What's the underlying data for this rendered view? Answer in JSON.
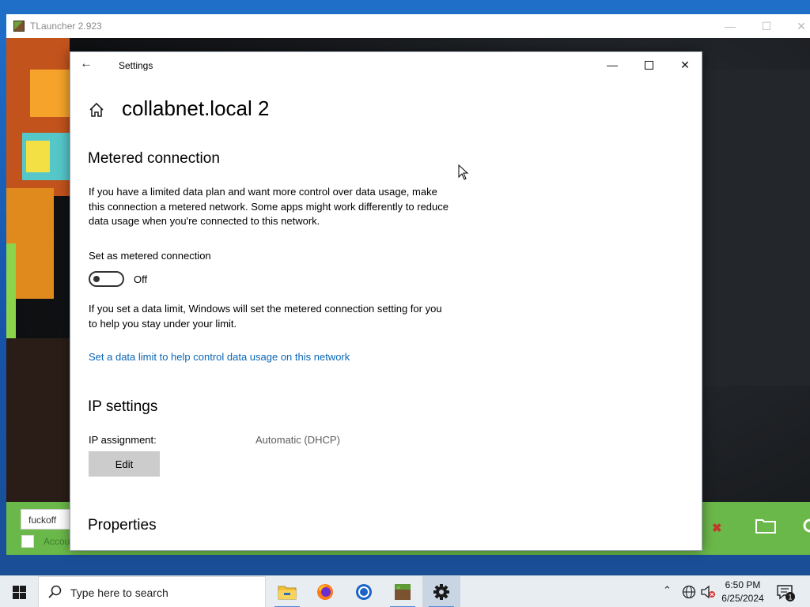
{
  "tlauncher": {
    "title": "TLauncher 2.923",
    "username": "fuckoff",
    "accounts_label": "Accounts"
  },
  "settings": {
    "app_title": "Settings",
    "page_title": "collabnet.local 2",
    "metered": {
      "title": "Metered connection",
      "description": "If you have a limited data plan and want more control over data usage, make this connection a metered network. Some apps might work differently to reduce data usage when you're connected to this network.",
      "toggle_label": "Set as metered connection",
      "toggle_state": "Off",
      "toggle_on": false,
      "data_limit_note": "If you set a data limit, Windows will set the metered connection setting for you to help you stay under your limit.",
      "data_limit_link": "Set a data limit to help control data usage on this network"
    },
    "ip": {
      "title": "IP settings",
      "assignment_label": "IP assignment:",
      "assignment_value": "Automatic (DHCP)",
      "edit_label": "Edit"
    },
    "properties": {
      "title": "Properties"
    }
  },
  "taskbar": {
    "search_placeholder": "Type here to search",
    "apps": [
      "file-explorer",
      "firefox",
      "chrome",
      "tlauncher",
      "settings"
    ],
    "clock_time": "6:50 PM",
    "clock_date": "6/25/2024",
    "notification_count": "1"
  },
  "colors": {
    "link": "#0a66b6",
    "tlauncher_green": "#6bb84a",
    "taskbar": "#e8edf2"
  }
}
